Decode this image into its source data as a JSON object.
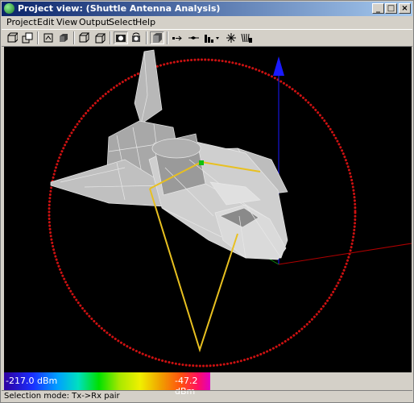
{
  "window": {
    "title": "Project view: (Shuttle Antenna Analysis)",
    "controls": {
      "minimize": "_",
      "maximize": "□",
      "close": "×"
    }
  },
  "menu": [
    "Project",
    "Edit",
    "View",
    "Output",
    "Select",
    "Help"
  ],
  "toolbar": {
    "icons": [
      "box-icon",
      "stack-icon",
      "frame-icon",
      "solid-icon",
      "cube-outline-icon",
      "cube-icon",
      "camera-icon",
      "camera-rotate-icon",
      "shaded-cube-icon",
      "arrow-right-icon",
      "double-arrow-icon",
      "bar-chart-dropdown-icon",
      "star-burst-icon",
      "antenna-icon"
    ]
  },
  "legend": {
    "min_label": "-217.0 dBm",
    "max_label": "-47.2 dBm"
  },
  "status": {
    "text": "Selection mode: Tx->Rx pair"
  },
  "colors": {
    "title_start": "#0a246a",
    "title_end": "#a6caf0",
    "ring": "#cc1111",
    "path": "#e8c020",
    "axis_blue": "#1a1aff",
    "axis_red": "#b00000",
    "axis_green": "#109010",
    "shuttle": "#c8c8c8"
  }
}
